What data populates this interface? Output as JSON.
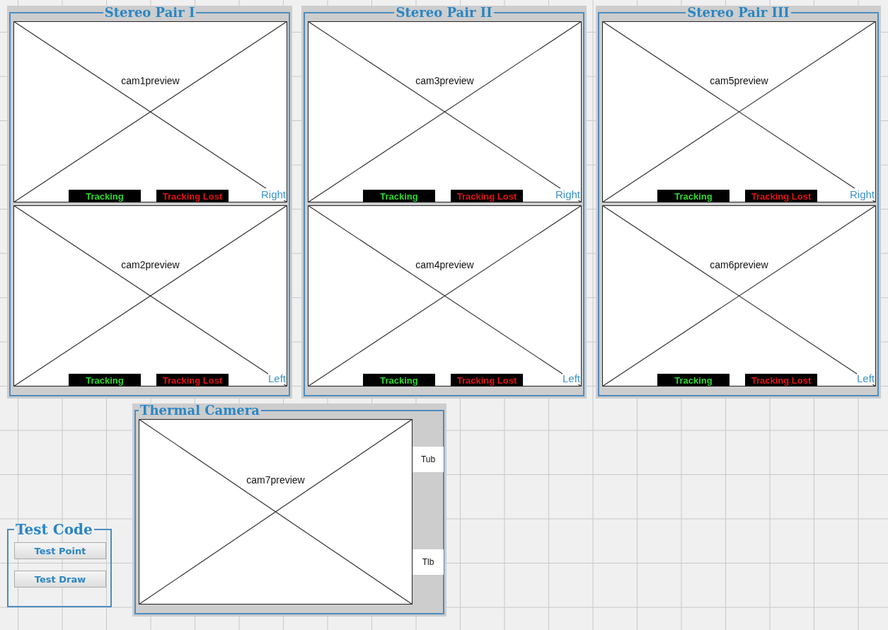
{
  "stereo_pairs": [
    {
      "title": "Stereo Pair I",
      "cameras": [
        {
          "preview": "cam1preview",
          "side": "Right",
          "statuses": [
            {
              "text": "Tracking",
              "kind": "tracking"
            },
            {
              "text": "Tracking Lost",
              "kind": "lost"
            }
          ]
        },
        {
          "preview": "cam2preview",
          "side": "Left",
          "statuses": [
            {
              "text": "Tracking",
              "kind": "tracking"
            },
            {
              "text": "Tracking Lost",
              "kind": "lost"
            }
          ]
        }
      ]
    },
    {
      "title": "Stereo Pair II",
      "cameras": [
        {
          "preview": "cam3preview",
          "side": "Right",
          "statuses": [
            {
              "text": "Tracking",
              "kind": "tracking"
            },
            {
              "text": "Tracking Lost",
              "kind": "lost"
            }
          ]
        },
        {
          "preview": "cam4preview",
          "side": "Left",
          "statuses": [
            {
              "text": "Tracking",
              "kind": "tracking"
            },
            {
              "text": "Tracking Lost",
              "kind": "lost"
            }
          ]
        }
      ]
    },
    {
      "title": "Stereo Pair III",
      "cameras": [
        {
          "preview": "cam5preview",
          "side": "Right",
          "statuses": [
            {
              "text": "Tracking",
              "kind": "tracking"
            },
            {
              "text": "Tracking Lost",
              "kind": "lost"
            }
          ]
        },
        {
          "preview": "cam6preview",
          "side": "Left",
          "statuses": [
            {
              "text": "Tracking",
              "kind": "tracking"
            },
            {
              "text": "Tracking Lost",
              "kind": "lost"
            }
          ]
        }
      ]
    }
  ],
  "test_code": {
    "title": "Test Code",
    "buttons": [
      "Test Point",
      "Test Draw"
    ]
  },
  "thermal_camera": {
    "title": "Thermal Camera",
    "preview": "cam7preview",
    "markers": [
      "Tub",
      "Tlb"
    ]
  }
}
